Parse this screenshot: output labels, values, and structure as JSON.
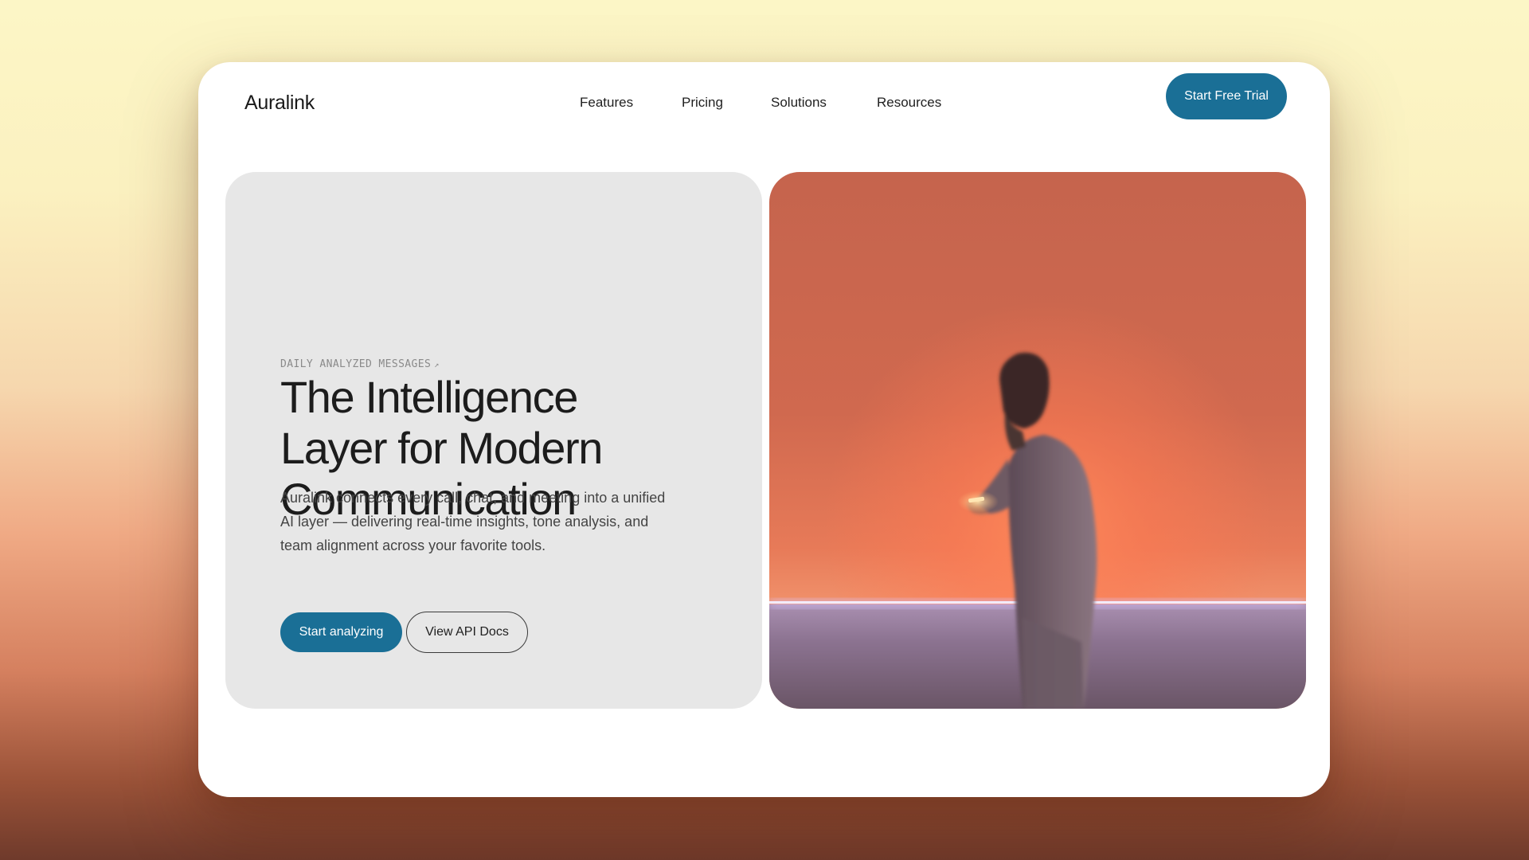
{
  "header": {
    "logo": "Auralink",
    "nav": [
      {
        "label": "Features"
      },
      {
        "label": "Pricing"
      },
      {
        "label": "Solutions"
      },
      {
        "label": "Resources"
      }
    ],
    "cta_label": "Start Free Trial"
  },
  "hero": {
    "eyebrow": "DAILY ANALYZED MESSAGES",
    "eyebrow_icon": "arrow-up-right-icon",
    "headline_lines": [
      "The Intelligence",
      "Layer for Modern",
      "Communication"
    ],
    "description_lines": [
      "Auralink connects every call, chat, and meeting into a unified",
      "AI layer — delivering real-time insights, tone analysis, and",
      "team alignment across your favorite tools."
    ],
    "primary_button": "Start analyzing",
    "secondary_button": "View API Docs"
  },
  "colors": {
    "accent": "#1a6f96",
    "card_background": "#e7e7e7",
    "window_background": "#ffffff"
  }
}
